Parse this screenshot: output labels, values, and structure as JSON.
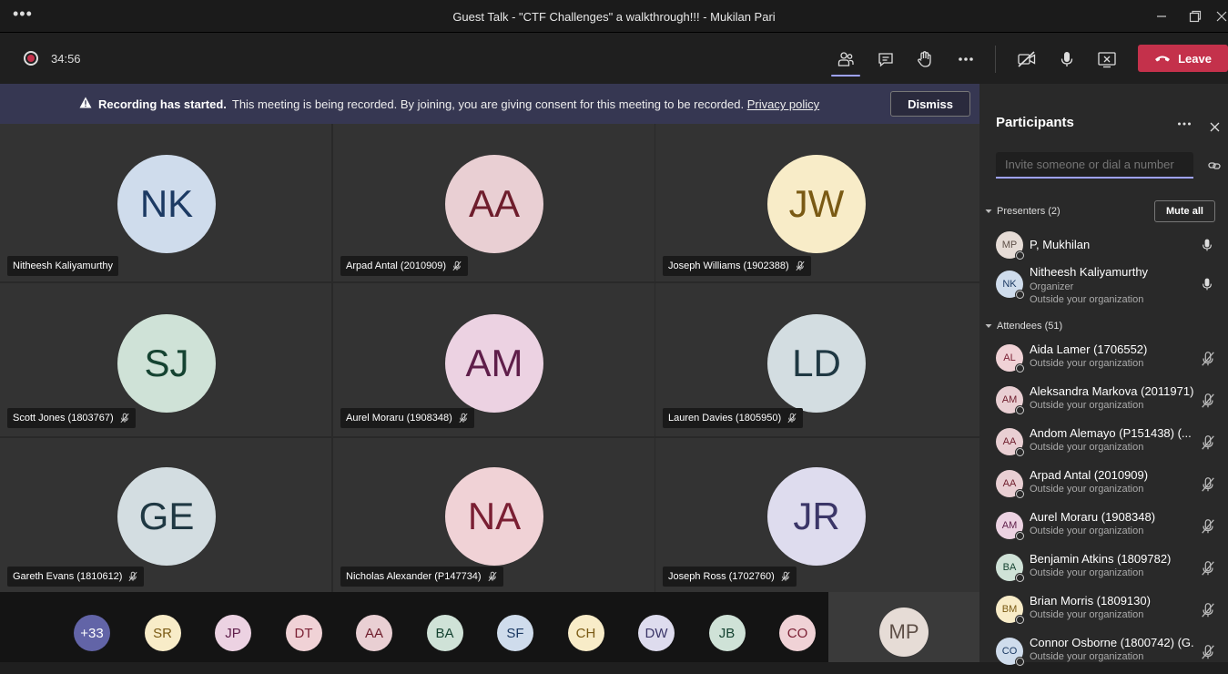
{
  "window": {
    "title": "Guest Talk - \"CTF Challenges\" a walkthrough!!! - Mukilan Pari",
    "menu_dots": "•••"
  },
  "toolbar": {
    "timer": "34:56",
    "leave_label": "Leave"
  },
  "banner": {
    "bold": "Recording has started.",
    "text": "This meeting is being recorded. By joining, you are giving consent for this meeting to be recorded.",
    "link": "Privacy policy",
    "dismiss": "Dismiss"
  },
  "tiles": [
    {
      "initials": "NK",
      "name": "Nitheesh Kaliyamurthy",
      "muted": false,
      "bg": "#cfdcec",
      "fg": "#1c3a63"
    },
    {
      "initials": "AA",
      "name": "Arpad Antal (2010909)",
      "muted": true,
      "bg": "#e9cfd3",
      "fg": "#6e1d2c"
    },
    {
      "initials": "JW",
      "name": "Joseph Williams (1902388)",
      "muted": true,
      "bg": "#f8ecc8",
      "fg": "#7a5a14"
    },
    {
      "initials": "SJ",
      "name": "Scott Jones (1803767)",
      "muted": true,
      "bg": "#cfe2d7",
      "fg": "#154331"
    },
    {
      "initials": "AM",
      "name": "Aurel Moraru (1908348)",
      "muted": true,
      "bg": "#ecd2e2",
      "fg": "#5f1e4a"
    },
    {
      "initials": "LD",
      "name": "Lauren Davies (1805950)",
      "muted": true,
      "bg": "#d3dde1",
      "fg": "#1f3843"
    },
    {
      "initials": "GE",
      "name": "Gareth Evans (1810612)",
      "muted": true,
      "bg": "#d3dde1",
      "fg": "#1f3843"
    },
    {
      "initials": "NA",
      "name": "Nicholas Alexander (P147734)",
      "muted": true,
      "bg": "#f0d2d6",
      "fg": "#7a1f33"
    },
    {
      "initials": "JR",
      "name": "Joseph Ross (1702760)",
      "muted": true,
      "bg": "#dedcee",
      "fg": "#3b3668"
    }
  ],
  "strip": [
    {
      "initials": "+33",
      "bg": "#6264a7",
      "fg": "#ffffff"
    },
    {
      "initials": "SR",
      "bg": "#f8ecc8",
      "fg": "#7a5a14"
    },
    {
      "initials": "JP",
      "bg": "#ecd2e2",
      "fg": "#5f1e4a"
    },
    {
      "initials": "DT",
      "bg": "#f0d2d6",
      "fg": "#7a1f33"
    },
    {
      "initials": "AA",
      "bg": "#e9cfd3",
      "fg": "#6e1d2c"
    },
    {
      "initials": "BA",
      "bg": "#cfe2d7",
      "fg": "#154331"
    },
    {
      "initials": "SF",
      "bg": "#cfdcec",
      "fg": "#1c3a63"
    },
    {
      "initials": "CH",
      "bg": "#f8ecc8",
      "fg": "#7a5a14"
    },
    {
      "initials": "DW",
      "bg": "#dedcee",
      "fg": "#3b3668"
    },
    {
      "initials": "JB",
      "bg": "#cfe2d7",
      "fg": "#154331"
    },
    {
      "initials": "CO",
      "bg": "#f0d2d6",
      "fg": "#7a1f33"
    }
  ],
  "self": {
    "initials": "MP"
  },
  "panel": {
    "title": "Participants",
    "invite_placeholder": "Invite someone or dial a number",
    "presenters_label": "Presenters (2)",
    "mute_all": "Mute all",
    "attendees_label": "Attendees (51)",
    "presenters": [
      {
        "initials": "MP",
        "name": "P, Mukhilan",
        "sub1": "",
        "sub2": "",
        "mic": "on",
        "bg": "#e6dcd6",
        "fg": "#5e4f47"
      },
      {
        "initials": "NK",
        "name": "Nitheesh Kaliyamurthy",
        "sub1": "Organizer",
        "sub2": "Outside your organization",
        "mic": "on",
        "bg": "#cfdcec",
        "fg": "#1c3a63"
      }
    ],
    "attendees": [
      {
        "initials": "AL",
        "name": "Aida Lamer (1706552)",
        "sub1": "Outside your organization",
        "bg": "#f0d2d6",
        "fg": "#7a1f33"
      },
      {
        "initials": "AM",
        "name": "Aleksandra Markova (2011971)",
        "sub1": "Outside your organization",
        "bg": "#e9cfd3",
        "fg": "#6e1d2c"
      },
      {
        "initials": "AA",
        "name": "Andom Alemayo (P151438) (...",
        "sub1": "Outside your organization",
        "bg": "#e9cfd3",
        "fg": "#6e1d2c"
      },
      {
        "initials": "AA",
        "name": "Arpad Antal (2010909)",
        "sub1": "Outside your organization",
        "bg": "#e9cfd3",
        "fg": "#6e1d2c"
      },
      {
        "initials": "AM",
        "name": "Aurel Moraru (1908348)",
        "sub1": "Outside your organization",
        "bg": "#ecd2e2",
        "fg": "#5f1e4a"
      },
      {
        "initials": "BA",
        "name": "Benjamin Atkins (1809782)",
        "sub1": "Outside your organization",
        "bg": "#cfe2d7",
        "fg": "#154331"
      },
      {
        "initials": "BM",
        "name": "Brian Morris (1809130)",
        "sub1": "Outside your organization",
        "bg": "#f8ecc8",
        "fg": "#7a5a14"
      },
      {
        "initials": "CO",
        "name": "Connor Osborne (1800742) (G...",
        "sub1": "Outside your organization",
        "bg": "#cfdcec",
        "fg": "#1c3a63"
      }
    ]
  }
}
